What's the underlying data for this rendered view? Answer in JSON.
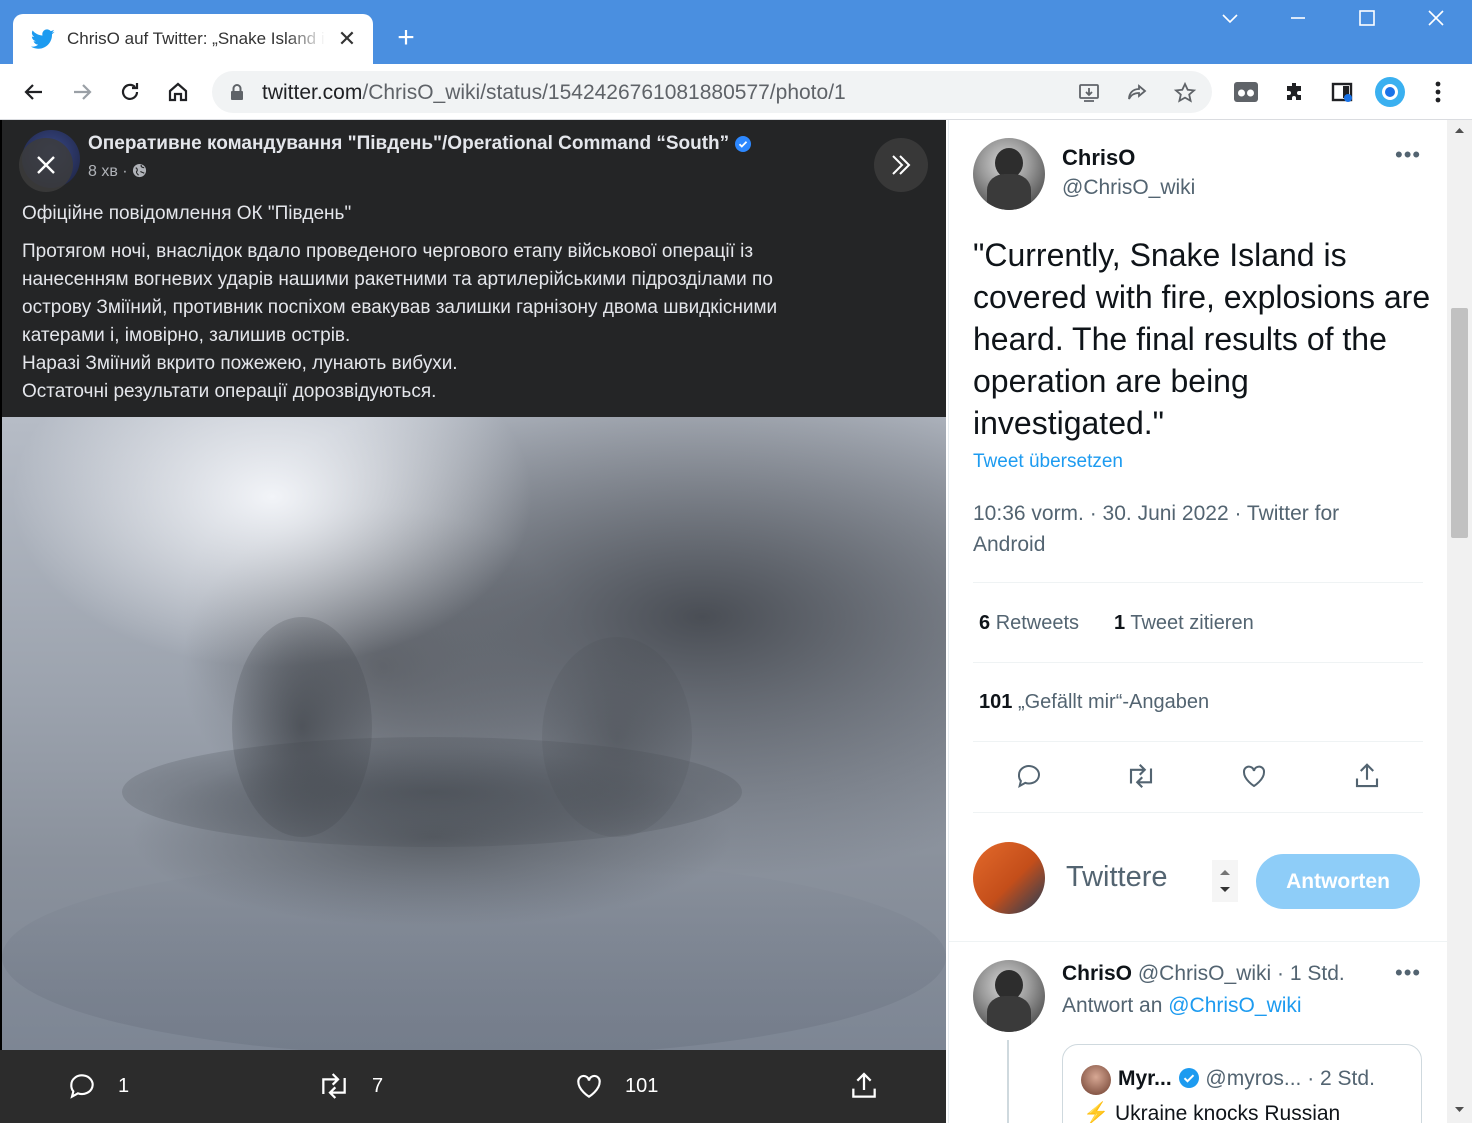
{
  "browser": {
    "tab_title": "ChrisO auf Twitter: „Snake Island is covered with fire",
    "url_host": "twitter.com",
    "url_path": "/ChrisO_wiki/status/1542426761081880577/photo/1",
    "accent_color": "#4a8fe0"
  },
  "facebook_post": {
    "page_name": "Оперативне командування \"Південь\"/Operational Command “South”",
    "time": "8 хв ·",
    "title": "Офіційне повідомлення ОК \"Південь\"",
    "body_lines": [
      "Протягом ночі, внаслідок вдало проведеного чергового етапу військової операції із",
      "нанесенням вогневих ударів нашими ракетними та артилерійськими підрозділами по",
      "острову Зміїний, противник поспіхом евакував залишки гарнізону двома швидкісними",
      "катерами і, імовірно, залишив острів.",
      "Наразі Зміїний вкрито пожежею,  лунають вибухи.",
      "Остаточні результати операції дорозвідуються."
    ]
  },
  "photo_actions": {
    "replies": "1",
    "retweets": "7",
    "likes": "101"
  },
  "tweet": {
    "author_name": "ChrisO",
    "author_handle": "@ChrisO_wiki",
    "text": "\"Currently, Snake Island is covered with fire, explosions are heard.  The final results of the operation are being investigated.\"",
    "translate": "Tweet übersetzen",
    "meta": "10:36 vorm. · 30. Juni 2022 · Twitter for Android",
    "retweets_count": "6",
    "retweets_label": "Retweets",
    "quotes_count": "1",
    "quotes_label": "Tweet zitieren",
    "likes_count": "101",
    "likes_label": "„Gefällt mir“-Angaben"
  },
  "reply_composer": {
    "placeholder": "Twittere",
    "button": "Antworten"
  },
  "reply": {
    "name": "ChrisO",
    "handle_time": "@ChrisO_wiki · 1 Std.",
    "reply_to_label": "Antwort an",
    "reply_to_handle": "@ChrisO_wiki",
    "quote_name": "Myr...",
    "quote_handle_time": "@myros... · 2 Std.",
    "quote_text": "⚡ Ukraine knocks Russian"
  }
}
